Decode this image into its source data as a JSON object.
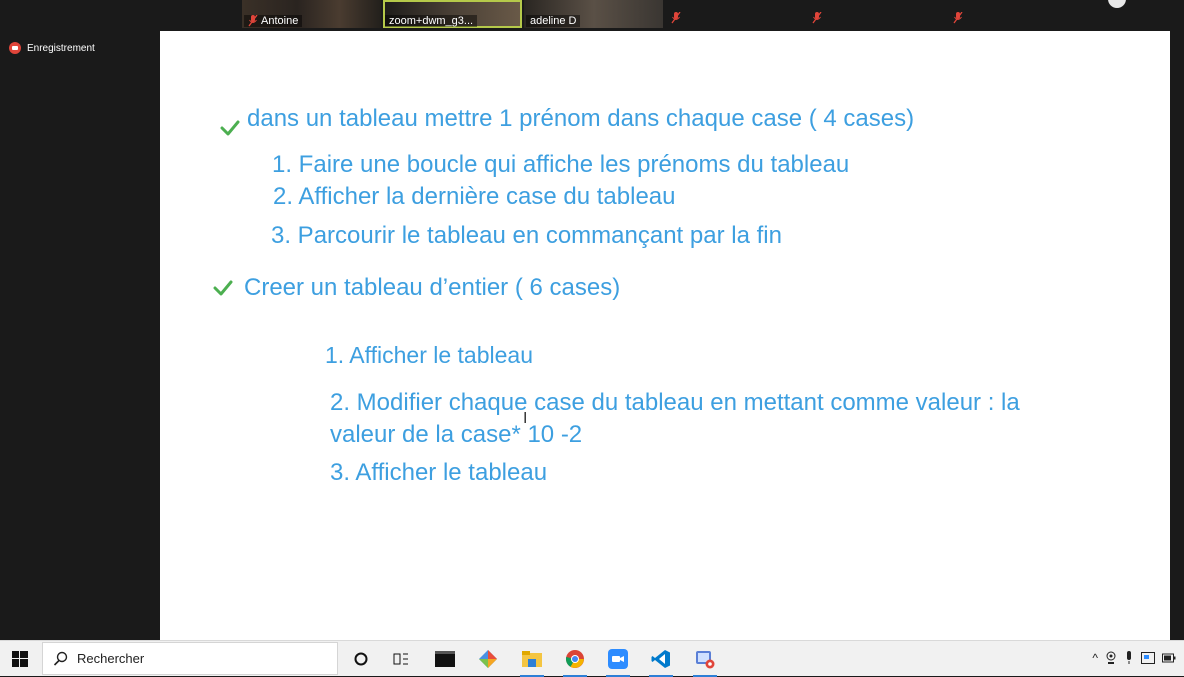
{
  "participants": [
    {
      "name": "Antoine",
      "muted": true
    },
    {
      "name": "zoom+dwm_g3...",
      "muted": false,
      "active": true
    },
    {
      "name": "adeline D",
      "muted": false
    }
  ],
  "recording": {
    "label": "Enregistrement"
  },
  "slide": {
    "items": [
      {
        "text": "dans un tableau mettre 1 prénom dans chaque  case ( 4 cases)",
        "check": true
      },
      {
        "text": "1. Faire une boucle qui affiche les prénoms du tableau"
      },
      {
        "text": "2. Afficher la dernière case du tableau"
      },
      {
        "text": "3. Parcourir le tableau en commançant par la fin"
      },
      {
        "text": "Creer un tableau d’entier ( 6 cases)",
        "check": true
      },
      {
        "text": "1. Afficher le tableau"
      },
      {
        "text": "2. Modifier chaque case du tableau en mettant comme valeur : la"
      },
      {
        "text": "valeur de la case* 10 -2"
      },
      {
        "text": "3. Afficher le tableau"
      }
    ]
  },
  "taskbar": {
    "search_placeholder": "Rechercher",
    "apps": [
      "cortana",
      "task-view",
      "terminal",
      "git",
      "file-explorer",
      "chrome",
      "zoom",
      "vscode",
      "snip-tool"
    ]
  },
  "colors": {
    "slide_text": "#3d9fe0",
    "check": "#4caf50",
    "recording": "#e0453a"
  }
}
